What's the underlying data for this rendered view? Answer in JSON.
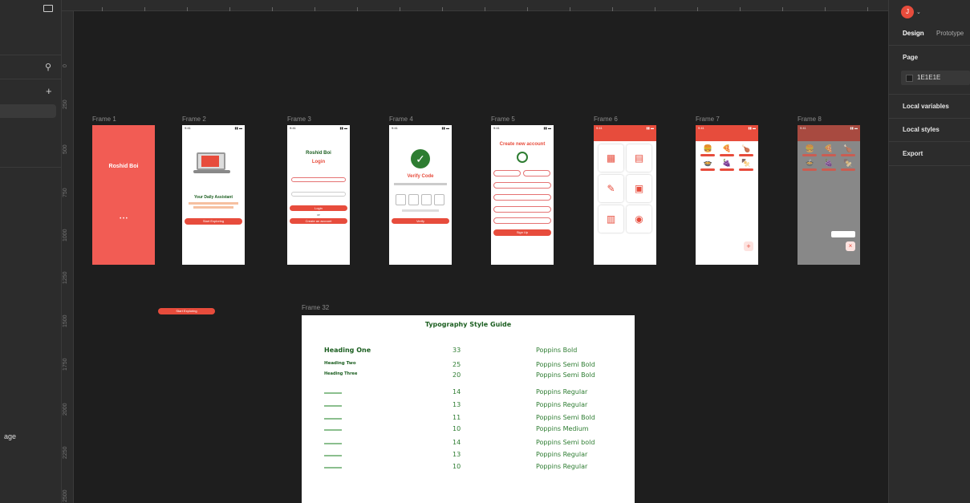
{
  "left_panel": {
    "bottom_label": "age"
  },
  "ruler": {
    "left_labels": [
      "0",
      "250",
      "500",
      "750",
      "1000",
      "1250",
      "1500",
      "1750",
      "2000",
      "2250",
      "2500"
    ]
  },
  "canvas": {
    "frame_labels": [
      "Frame 1",
      "Frame 2",
      "Frame 3",
      "Frame 4",
      "Frame 5",
      "Frame 6",
      "Frame 7",
      "Frame 8",
      "Frame 32"
    ],
    "statusbar_time": "9:41",
    "f1": {
      "title": "Roshid Boi",
      "dots": "• • •"
    },
    "f2": {
      "heading": "Your Daily Assistant",
      "button": "Start Exploring"
    },
    "f3": {
      "brand": "Roshid Boi",
      "title": "Login",
      "or": "or",
      "login_btn": "Login",
      "create_btn": "Create an account"
    },
    "f4": {
      "title": "Verify Code",
      "verify_btn": "Verify"
    },
    "f5": {
      "title": "Create new account",
      "signup_btn": "Sign Up"
    },
    "loose_button": "Start Exploring"
  },
  "typography": {
    "title": "Typography Style Guide",
    "rows": [
      {
        "name": "Heading One",
        "size": "33",
        "font": "Poppins Bold"
      },
      {
        "name": "Heading Two",
        "size": "25",
        "font": "Poppins  Semi Bold"
      },
      {
        "name": "Heading Three",
        "size": "20",
        "font": "Poppins  Semi Bold"
      },
      {
        "name": "",
        "size": "14",
        "font": "Poppins Regular"
      },
      {
        "name": "",
        "size": "13",
        "font": "Poppins Regular"
      },
      {
        "name": "",
        "size": "11",
        "font": "Poppins  Semi Bold"
      },
      {
        "name": "",
        "size": "10",
        "font": "Poppins  Medium"
      },
      {
        "name": "",
        "size": "14",
        "font": "Poppins Semi bold"
      },
      {
        "name": "",
        "size": "13",
        "font": "Poppins Regular"
      },
      {
        "name": "",
        "size": "10",
        "font": "Poppins Regular"
      }
    ]
  },
  "right_panel": {
    "avatar_initial": "J",
    "tab_design": "Design",
    "tab_prototype": "Prototype",
    "page_label": "Page",
    "page_color": "1E1E1E",
    "local_variables": "Local variables",
    "local_styles": "Local styles",
    "export": "Export"
  },
  "colors": {
    "accent": "#e74c3c",
    "frame1_bg": "#f25c54",
    "canvas": "#1e1e1e",
    "panel": "#2c2c2c",
    "type_green": "#1b5e20"
  }
}
